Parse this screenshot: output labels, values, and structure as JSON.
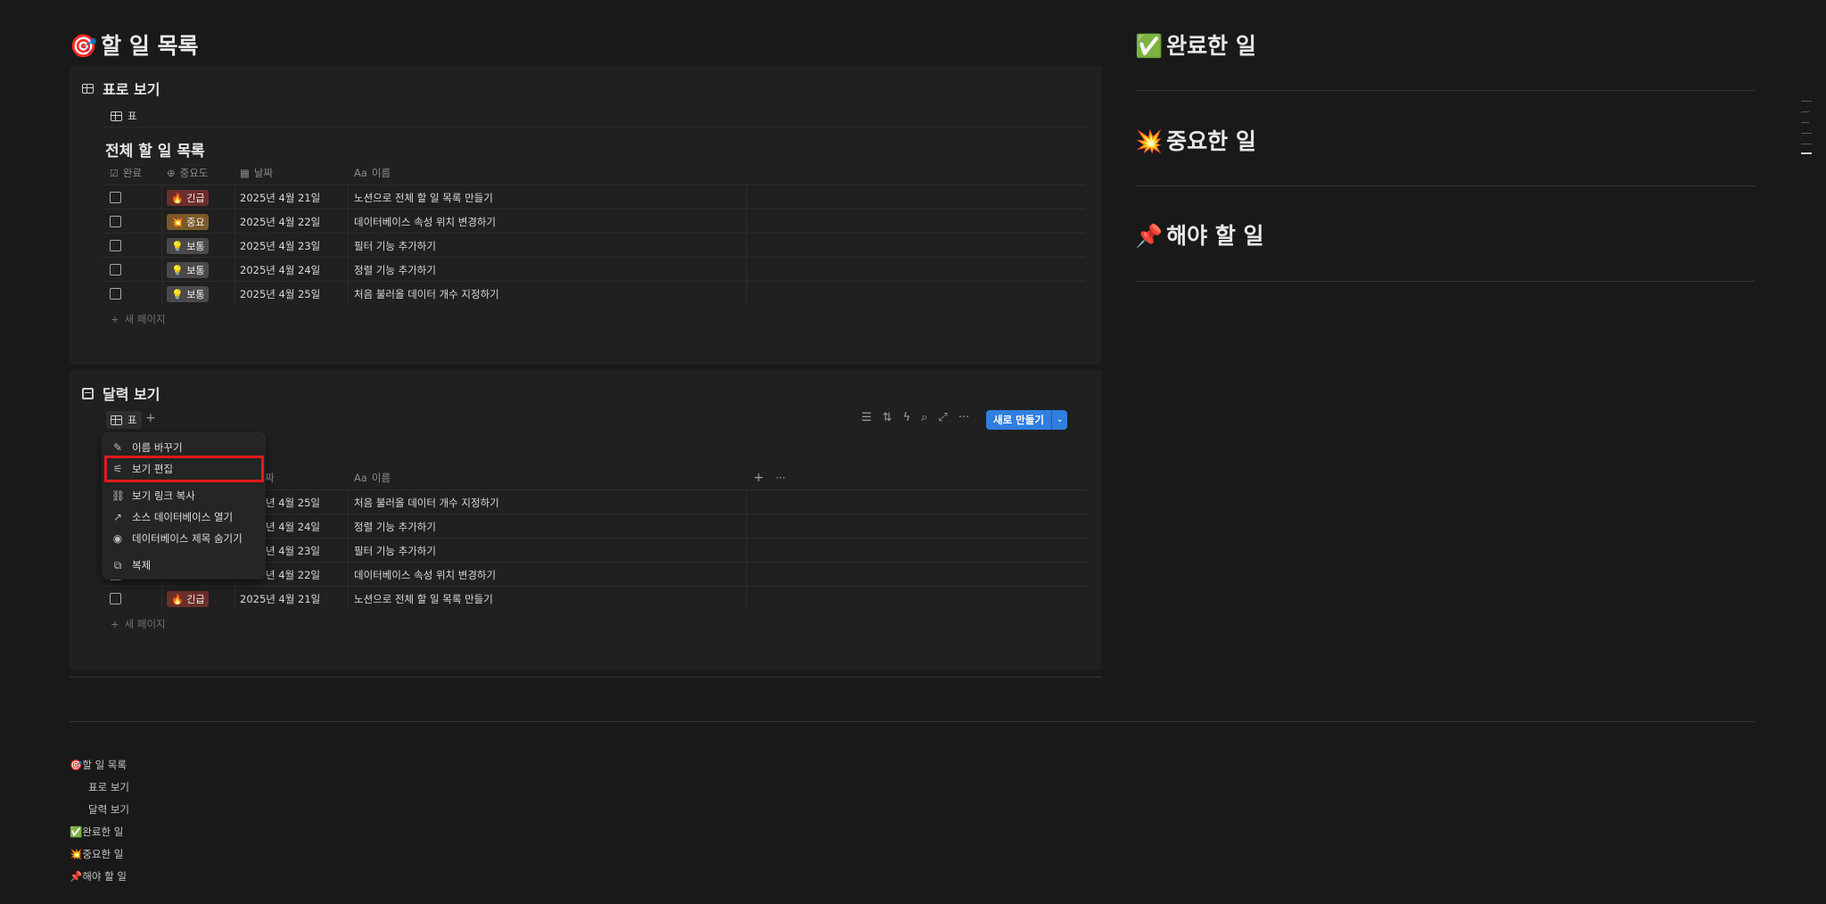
{
  "page": {
    "title": "할 일 목록",
    "title_emoji": "🎯"
  },
  "table_view": {
    "section_title": "표로 보기",
    "tab_label": "표",
    "db_title": "전체 할 일 목록",
    "columns": [
      "완료",
      "중요도",
      "날짜",
      "이름"
    ],
    "rows": [
      {
        "priority": "긴급",
        "priority_icon": "🔥",
        "priority_color": "#6b2f2a",
        "date": "2025년 4월 21일",
        "name": "노션으로 전체 할 일 목록 만들기"
      },
      {
        "priority": "중요",
        "priority_icon": "💥",
        "priority_color": "#7a5a2a",
        "date": "2025년 4월 22일",
        "name": "데이터베이스 속성 위치 변경하기"
      },
      {
        "priority": "보통",
        "priority_icon": "💡",
        "priority_color": "#4a4a4a",
        "date": "2025년 4월 23일",
        "name": "필터 기능 추가하기"
      },
      {
        "priority": "보통",
        "priority_icon": "💡",
        "priority_color": "#4a4a4a",
        "date": "2025년 4월 24일",
        "name": "정렬 기능 추가하기"
      },
      {
        "priority": "보통",
        "priority_icon": "💡",
        "priority_color": "#4a4a4a",
        "date": "2025년 4월 25일",
        "name": "처음 불러올 데이터 개수 지정하기"
      }
    ],
    "new_page": "새 페이지"
  },
  "calendar_view": {
    "section_title": "달력 보기",
    "tab_label": "표",
    "new_button": "새로 만들기",
    "columns_visible": [
      "짜",
      "이름"
    ],
    "rows": [
      {
        "date_partial": "년 4월 25일",
        "name": "처음 불러올 데이터 개수 지정하기"
      },
      {
        "date_partial": "년 4월 24일",
        "name": "정렬 기능 추가하기"
      },
      {
        "date_partial": "년 4월 23일",
        "name": "필터 기능 추가하기"
      },
      {
        "date_partial": "년 4월 22일",
        "name": "데이터베이스 속성 위치 변경하기"
      },
      {
        "priority": "긴급",
        "priority_icon": "🔥",
        "date": "2025년 4월 21일",
        "name": "노션으로 전체 할 일 목록 만들기"
      }
    ],
    "new_page": "새 페이지"
  },
  "context_menu": {
    "items": [
      {
        "icon": "edit-icon",
        "label": "이름 바꾸기"
      },
      {
        "icon": "sliders-icon",
        "label": "보기 편집"
      },
      {
        "icon": "link-icon",
        "label": "보기 링크 복사"
      },
      {
        "icon": "arrow-up-right-icon",
        "label": "소스 데이터베이스 열기"
      },
      {
        "icon": "eye-icon",
        "label": "데이터베이스 제목 숨기기"
      },
      {
        "icon": "copy-icon",
        "label": "복제"
      }
    ]
  },
  "right": {
    "done": {
      "emoji": "✅",
      "title": "완료한 일"
    },
    "important": {
      "emoji": "💥",
      "title": "중요한 일"
    },
    "todo": {
      "emoji": "📌",
      "title": "해야 할 일"
    }
  },
  "toc": {
    "items": [
      {
        "emoji": "🎯",
        "label": "할 일 목록"
      },
      {
        "emoji": "",
        "label": "표로 보기"
      },
      {
        "emoji": "",
        "label": "달력 보기"
      },
      {
        "emoji": "✅",
        "label": "완료한 일"
      },
      {
        "emoji": "💥",
        "label": "중요한 일"
      },
      {
        "emoji": "📌",
        "label": "해야 할 일"
      }
    ]
  },
  "colors": {
    "background": "#191919",
    "panel": "#202020",
    "accent": "#2f7ee0",
    "highlight": "#e11b1b"
  }
}
